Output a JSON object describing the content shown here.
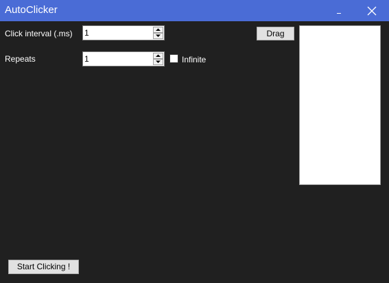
{
  "window": {
    "title": "AutoClicker",
    "titlebar_color": "#4a6cd6",
    "background_color": "#202020",
    "minimize_icon": "minimize-icon",
    "close_icon": "close-icon"
  },
  "form": {
    "interval_label": "Click interval (.ms)",
    "interval_value": "1",
    "repeats_label": "Repeats",
    "repeats_value": "1",
    "infinite_label": "Infinite",
    "infinite_checked": false
  },
  "buttons": {
    "drag_label": "Drag",
    "start_label": "Start Clicking !"
  }
}
